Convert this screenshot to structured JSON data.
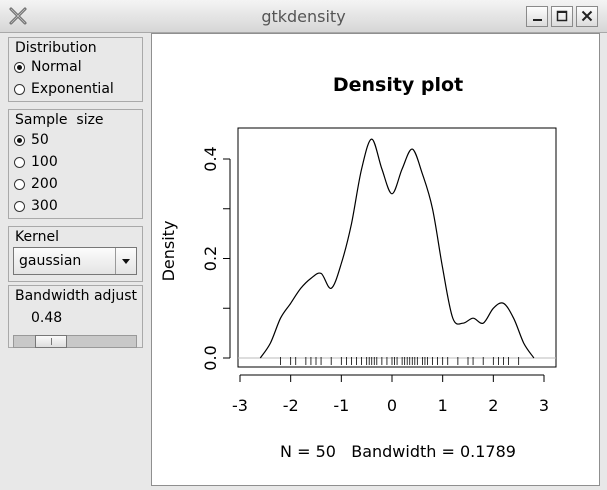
{
  "window": {
    "title": "gtkdensity"
  },
  "distribution": {
    "label": "Distribution",
    "options": [
      "Normal",
      "Exponential"
    ],
    "selected": "Normal"
  },
  "sample_size": {
    "label": "Sample  size",
    "options": [
      "50",
      "100",
      "200",
      "300"
    ],
    "selected": "50"
  },
  "kernel": {
    "label": "Kernel",
    "value": "gaussian"
  },
  "bandwidth": {
    "label": "Bandwidth adjust",
    "value": "0.48",
    "slider_fraction": 0.23
  },
  "chart_data": {
    "type": "line",
    "title": "Density plot",
    "xlabel": "N = 50   Bandwidth = 0.1789",
    "ylabel": "Density",
    "xlim": [
      -3,
      3
    ],
    "ylim": [
      0,
      0.45
    ],
    "x_ticks": [
      "-3",
      "-2",
      "-1",
      "0",
      "1",
      "2",
      "3"
    ],
    "y_ticks": [
      "0.0",
      "0.2",
      "0.4"
    ],
    "series": [
      {
        "x": [
          -2.6,
          -2.4,
          -2.2,
          -2.0,
          -1.8,
          -1.6,
          -1.4,
          -1.2,
          -1.0,
          -0.8,
          -0.6,
          -0.4,
          -0.2,
          0.0,
          0.2,
          0.4,
          0.6,
          0.8,
          1.0,
          1.2,
          1.4,
          1.6,
          1.8,
          2.0,
          2.2,
          2.4,
          2.6,
          2.8
        ],
        "y": [
          0.0,
          0.03,
          0.08,
          0.11,
          0.14,
          0.16,
          0.17,
          0.14,
          0.19,
          0.27,
          0.38,
          0.44,
          0.38,
          0.33,
          0.38,
          0.42,
          0.37,
          0.3,
          0.18,
          0.08,
          0.07,
          0.08,
          0.07,
          0.1,
          0.11,
          0.08,
          0.03,
          0.0
        ]
      }
    ],
    "rug": [
      -2.2,
      -2.0,
      -1.9,
      -1.7,
      -1.6,
      -1.5,
      -1.4,
      -1.2,
      -1.0,
      -0.9,
      -0.8,
      -0.7,
      -0.6,
      -0.5,
      -0.45,
      -0.4,
      -0.35,
      -0.3,
      -0.2,
      -0.1,
      0.0,
      0.05,
      0.1,
      0.2,
      0.25,
      0.3,
      0.35,
      0.4,
      0.45,
      0.5,
      0.6,
      0.65,
      0.7,
      0.8,
      0.9,
      1.0,
      1.1,
      1.3,
      1.5,
      1.6,
      1.8,
      2.0,
      2.1,
      2.2,
      2.3,
      2.5
    ]
  }
}
